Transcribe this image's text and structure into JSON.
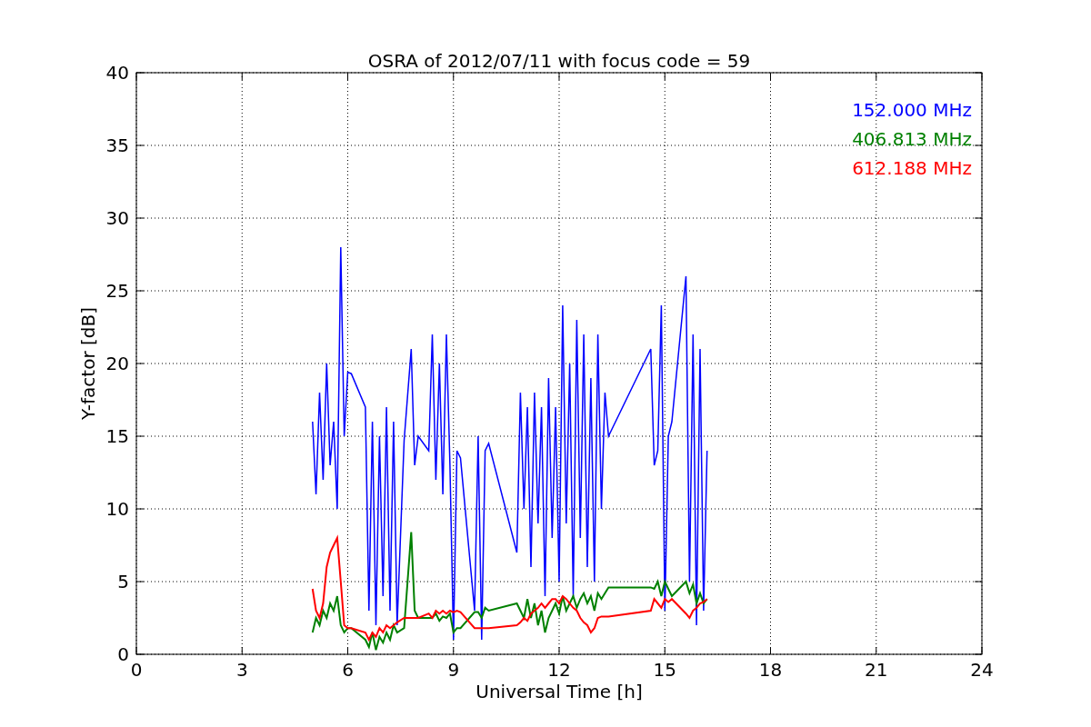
{
  "figure": {
    "chart_data": {
      "type": "line",
      "grid": true,
      "title": "OSRA of 2012/07/11 with focus code = 59",
      "xlabel": "Universal Time [h]",
      "ylabel": "Y-factor [dB]",
      "xlim": [
        0,
        24
      ],
      "ylim": [
        0,
        40
      ],
      "xticks": [
        0,
        3,
        6,
        9,
        12,
        15,
        18,
        21,
        24
      ],
      "yticks": [
        0,
        5,
        10,
        15,
        20,
        25,
        30,
        35,
        40
      ],
      "x": [
        5.0,
        5.1,
        5.2,
        5.3,
        5.4,
        5.5,
        5.6,
        5.7,
        5.8,
        5.9,
        6.0,
        6.1,
        6.5,
        6.6,
        6.7,
        6.8,
        6.9,
        7.0,
        7.1,
        7.2,
        7.3,
        7.4,
        7.6,
        7.8,
        7.9,
        8.0,
        8.3,
        8.4,
        8.5,
        8.6,
        8.7,
        8.8,
        8.9,
        9.0,
        9.1,
        9.2,
        9.6,
        9.7,
        9.8,
        9.9,
        10.0,
        10.8,
        10.9,
        11.0,
        11.1,
        11.2,
        11.3,
        11.4,
        11.5,
        11.6,
        11.7,
        11.8,
        11.9,
        12.0,
        12.1,
        12.2,
        12.3,
        12.4,
        12.5,
        12.6,
        12.7,
        12.8,
        12.9,
        13.0,
        13.1,
        13.2,
        13.3,
        13.4,
        14.6,
        14.7,
        14.8,
        14.9,
        15.0,
        15.1,
        15.2,
        15.6,
        15.7,
        15.8,
        15.9,
        16.0,
        16.1,
        16.2
      ],
      "series": [
        {
          "name": "152.000 MHz",
          "color": "#0000ff",
          "values": [
            16,
            11,
            18,
            12,
            20,
            13,
            16,
            10,
            28,
            15,
            19.4,
            19.3,
            17,
            3,
            16,
            2,
            15,
            4,
            17,
            3,
            16,
            2,
            14.7,
            21,
            13,
            15,
            14,
            22,
            12,
            20,
            11,
            22,
            13,
            1,
            14,
            13.5,
            3,
            15,
            1,
            14,
            14.5,
            7,
            18,
            10,
            17,
            6,
            18,
            9,
            17,
            4,
            19,
            8,
            17,
            5,
            24,
            9,
            20,
            4,
            23,
            8,
            22,
            6,
            19,
            5,
            22,
            10,
            18,
            15,
            21,
            13,
            14,
            24,
            3,
            15,
            16,
            26,
            5,
            22,
            2,
            21,
            3,
            14
          ]
        },
        {
          "name": "406.813 MHz",
          "color": "#008000",
          "values": [
            1.5,
            2.5,
            2,
            3,
            2.5,
            3.5,
            3,
            4,
            2,
            1.5,
            1.8,
            1.8,
            1,
            0.5,
            1.5,
            0.3,
            1.2,
            0.8,
            1.5,
            1,
            2,
            1.5,
            1.8,
            8.4,
            3,
            2.5,
            2.5,
            2.5,
            2.8,
            2.3,
            2.6,
            2.5,
            2.8,
            1.5,
            1.8,
            1.8,
            2.9,
            2.9,
            2.5,
            3.2,
            3,
            3.5,
            3,
            2.5,
            3.8,
            2.5,
            3.5,
            2,
            3,
            1.5,
            2.5,
            3,
            3.5,
            2.8,
            4,
            3,
            3.5,
            4,
            3.2,
            3.8,
            4.2,
            3.5,
            4,
            3,
            4.2,
            3.8,
            4.2,
            4.6,
            4.6,
            4.5,
            5,
            4,
            5,
            4.5,
            4,
            5,
            4.2,
            4.8,
            3.5,
            4.2,
            3.5,
            3.8
          ]
        },
        {
          "name": "612.188 MHz",
          "color": "#ff0000",
          "values": [
            4.5,
            3,
            2.5,
            3.5,
            6,
            7,
            7.5,
            8,
            5,
            2,
            1.8,
            1.8,
            1.5,
            1,
            1.5,
            1.2,
            1.8,
            1.5,
            2,
            1.8,
            2,
            2.2,
            2.5,
            2.5,
            2.5,
            2.5,
            2.8,
            2.5,
            3,
            2.8,
            3,
            2.8,
            3,
            2.9,
            3,
            2.9,
            1.8,
            1.8,
            1.8,
            1.8,
            1.8,
            2,
            2.2,
            2.5,
            2.3,
            2.8,
            3,
            3.2,
            3.5,
            3.2,
            3.5,
            3.8,
            3.8,
            3.5,
            4,
            3.8,
            3.5,
            3.2,
            3,
            2.5,
            2.2,
            2,
            1.5,
            1.8,
            2.5,
            2.6,
            2.6,
            2.6,
            3,
            3.8,
            3.5,
            3.2,
            3.8,
            3.6,
            3.8,
            2.8,
            2.5,
            3,
            3.2,
            3.5,
            3.6,
            3.8
          ]
        }
      ]
    }
  }
}
